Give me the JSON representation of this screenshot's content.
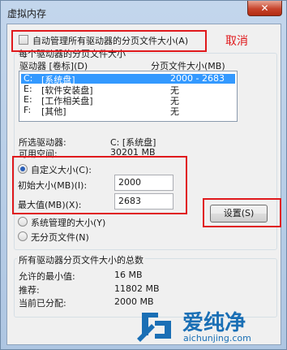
{
  "window": {
    "title": "虚拟内存",
    "close_glyph": "✕"
  },
  "auto_manage": {
    "label": "自动管理所有驱动器的分页文件大小(A)",
    "checked": false
  },
  "annotation": {
    "text": "取消"
  },
  "drives_group": {
    "legend": "每个驱动器的分页文件大小",
    "header_drive": "驱动器 [卷标](D)",
    "header_size": "分页文件大小(MB)",
    "rows": [
      {
        "drive": "C:",
        "label": "[系统盘]",
        "size": "2000 - 2683",
        "selected": true
      },
      {
        "drive": "E:",
        "label": "[软件安装盘]",
        "size": "无",
        "selected": false
      },
      {
        "drive": "E:",
        "label": "[工作相关盘]",
        "size": "无",
        "selected": false
      },
      {
        "drive": "F:",
        "label": "[其他]",
        "size": "无",
        "selected": false
      }
    ],
    "selected_drive_label": "所选驱动器:",
    "selected_drive_value": "C:  [系统盘]",
    "free_space_label": "可用空间:",
    "free_space_value": "30201 MB",
    "custom_size_label": "自定义大小(C):",
    "initial_size_label": "初始大小(MB)(I):",
    "initial_size_value": "2000",
    "max_size_label": "最大值(MB)(X):",
    "max_size_value": "2683",
    "system_managed_label": "系统管理的大小(Y)",
    "no_paging_label": "无分页文件(N)",
    "set_button": "设置(S)",
    "selected_option": "custom"
  },
  "totals_group": {
    "legend": "所有驱动器分页文件大小的总数",
    "min_allowed_label": "允许的最小值:",
    "min_allowed_value": "16 MB",
    "recommended_label": "推荐:",
    "recommended_value": "11802 MB",
    "allocated_label": "当前已分配:",
    "allocated_value": "2000 MB"
  },
  "watermark": {
    "text": "爱纯净",
    "url": "aichunjing.com"
  },
  "colors": {
    "highlight": "#e0191c",
    "selection": "#3399ff",
    "logo": "#1a6fb5"
  }
}
